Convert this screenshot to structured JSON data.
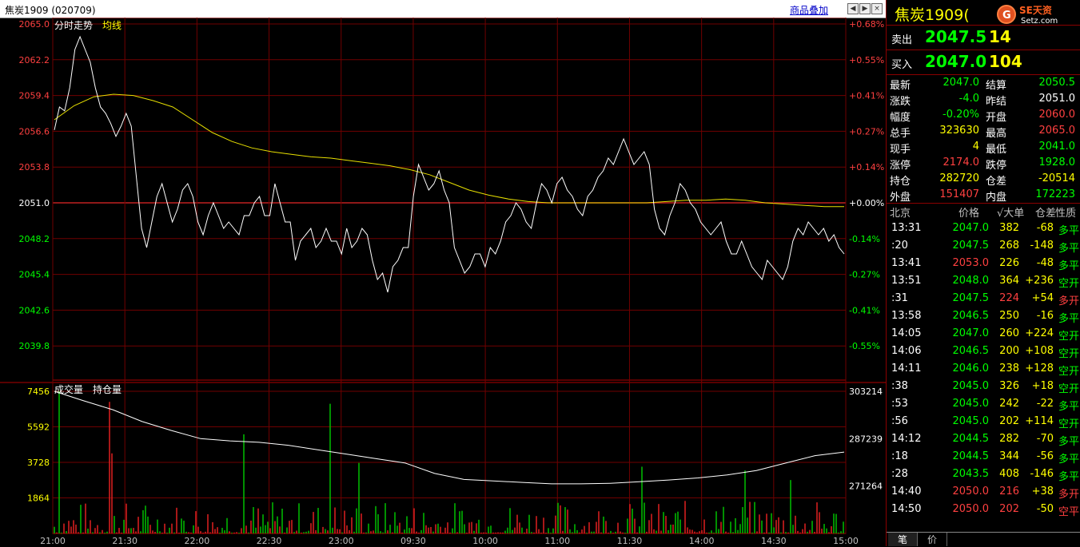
{
  "title_bar": {
    "title": "焦炭1909 (020709)",
    "overlay_label": "商品叠加"
  },
  "chart_data": [
    {
      "type": "line",
      "title": "分时走势",
      "legend": [
        "分时走势",
        "均线"
      ],
      "price_axis": [
        "2065.0",
        "2062.2",
        "2059.4",
        "2056.6",
        "2053.8",
        "2051.0",
        "2048.2",
        "2045.4",
        "2042.6",
        "2039.8"
      ],
      "pct_axis": [
        "+0.68%",
        "+0.55%",
        "+0.41%",
        "+0.27%",
        "+0.14%",
        "+0.00%",
        "-0.14%",
        "-0.27%",
        "-0.41%",
        "-0.55%"
      ],
      "ylim": [
        2037.0,
        2065.0
      ],
      "base_price": 2051.0,
      "x_ticks": [
        "21:00",
        "21:30",
        "22:00",
        "22:30",
        "23:00",
        "09:30",
        "10:00",
        "11:00",
        "11:30",
        "14:00",
        "14:30",
        "15:00"
      ],
      "series": [
        {
          "name": "分时走势",
          "values": [
            2056.7,
            2058.5,
            2058.2,
            2060.0,
            2063.0,
            2064.0,
            2063.0,
            2062.0,
            2060.0,
            2058.5,
            2058.0,
            2057.2,
            2056.2,
            2057.0,
            2058.0,
            2057.0,
            2053.0,
            2049.0,
            2047.5,
            2049.5,
            2051.5,
            2052.5,
            2051.0,
            2049.5,
            2050.5,
            2052.0,
            2052.5,
            2051.5,
            2049.5,
            2048.5,
            2050.0,
            2051.0,
            2050.0,
            2049.0,
            2049.5,
            2049.0,
            2048.5,
            2050.0,
            2050.0,
            2051.0,
            2051.5,
            2050.0,
            2050.0,
            2052.5,
            2051.0,
            2049.5,
            2049.5,
            2046.5,
            2048.0,
            2048.5,
            2049.0,
            2047.5,
            2048.0,
            2049.0,
            2048.0,
            2048.0,
            2047.0,
            2049.0,
            2047.5,
            2048.0,
            2049.0,
            2048.5,
            2046.5,
            2045.0,
            2045.5,
            2044.0,
            2046.0,
            2046.5,
            2047.5,
            2047.5,
            2051.5,
            2054.0,
            2053.0,
            2052.0,
            2052.5,
            2053.5,
            2052.0,
            2051.0,
            2047.5,
            2046.5,
            2045.5,
            2046.0,
            2047.0,
            2047.0,
            2046.0,
            2047.5,
            2047.0,
            2048.0,
            2049.5,
            2050.0,
            2051.0,
            2050.5,
            2049.5,
            2049.0,
            2051.0,
            2052.5,
            2052.0,
            2051.0,
            2052.5,
            2053.0,
            2052.0,
            2051.5,
            2050.5,
            2050.0,
            2051.5,
            2052.0,
            2053.0,
            2053.5,
            2054.5,
            2054.0,
            2055.0,
            2056.0,
            2055.0,
            2054.0,
            2054.5,
            2055.0,
            2054.0,
            2050.5,
            2049.0,
            2048.5,
            2050.0,
            2051.0,
            2052.5,
            2052.0,
            2051.0,
            2050.5,
            2049.5,
            2049.0,
            2048.5,
            2049.0,
            2049.5,
            2048.0,
            2047.0,
            2047.0,
            2048.0,
            2047.0,
            2046.0,
            2045.5,
            2045.0,
            2046.5,
            2046.0,
            2045.5,
            2045.0,
            2046.0,
            2048.0,
            2049.0,
            2048.5,
            2049.5,
            2049.0,
            2048.5,
            2049.0,
            2048.0,
            2048.5,
            2047.5,
            2047.0
          ]
        },
        {
          "name": "均线",
          "values": [
            2057.5,
            2058.6,
            2059.3,
            2059.5,
            2059.4,
            2059.0,
            2058.5,
            2057.5,
            2056.5,
            2055.8,
            2055.3,
            2055.0,
            2054.8,
            2054.6,
            2054.5,
            2054.3,
            2054.1,
            2053.9,
            2053.6,
            2053.2,
            2052.6,
            2052.0,
            2051.6,
            2051.3,
            2051.1,
            2051.0,
            2051.0,
            2051.0,
            2051.0,
            2051.0,
            2051.0,
            2051.1,
            2051.2,
            2051.2,
            2051.3,
            2051.2,
            2051.0,
            2050.9,
            2050.8,
            2050.7,
            2050.7
          ]
        }
      ]
    },
    {
      "type": "bar",
      "title": "成交量",
      "legend": [
        "成交量",
        "持仓量"
      ],
      "volume_axis": [
        "7456",
        "5592",
        "3728",
        "1864"
      ],
      "oi_axis": [
        "303214",
        "287239",
        "271264"
      ],
      "ylim": [
        0,
        7456
      ],
      "x_ticks": [
        "21:00",
        "21:30",
        "22:00",
        "22:30",
        "23:00",
        "09:30",
        "10:00",
        "11:00",
        "11:30",
        "14:00",
        "14:30",
        "15:00"
      ],
      "series": [
        {
          "name": "持仓量",
          "values": [
            303214,
            300000,
            297000,
            293000,
            290000,
            287239,
            286500,
            286000,
            285000,
            283500,
            282000,
            280500,
            279000,
            275500,
            273500,
            273000,
            272500,
            272000,
            272000,
            272200,
            272700,
            273300,
            274000,
            275000,
            276500,
            279000,
            281500,
            282720
          ]
        }
      ]
    }
  ],
  "side_panel": {
    "name": "焦炭1909(",
    "logo_text": "SE天资",
    "logo_sub": "Setz.com",
    "ask": {
      "label": "卖出",
      "price": "2047.5",
      "vol": "14"
    },
    "bid": {
      "label": "买入",
      "price": "2047.0",
      "vol": "104"
    },
    "quote": [
      {
        "l1": "最新",
        "v1": "2047.0",
        "c1": "#00ff00",
        "l2": "结算",
        "v2": "2050.5",
        "c2": "#00ff00"
      },
      {
        "l1": "涨跌",
        "v1": "-4.0",
        "c1": "#00ff00",
        "l2": "昨结",
        "v2": "2051.0",
        "c2": "#ffffff"
      },
      {
        "l1": "幅度",
        "v1": "-0.20%",
        "c1": "#00ff00",
        "l2": "开盘",
        "v2": "2060.0",
        "c2": "#ff4040"
      },
      {
        "l1": "总手",
        "v1": "323630",
        "c1": "#ffff00",
        "l2": "最高",
        "v2": "2065.0",
        "c2": "#ff4040"
      },
      {
        "l1": "现手",
        "v1": "4",
        "c1": "#ffff00",
        "l2": "最低",
        "v2": "2041.0",
        "c2": "#00ff00"
      },
      {
        "l1": "涨停",
        "v1": "2174.0",
        "c1": "#ff4040",
        "l2": "跌停",
        "v2": "1928.0",
        "c2": "#00ff00"
      },
      {
        "l1": "持仓",
        "v1": "282720",
        "c1": "#ffff00",
        "l2": "仓差",
        "v2": "-20514",
        "c2": "#ffff00"
      },
      {
        "l1": "外盘",
        "v1": "151407",
        "c1": "#ff4040",
        "l2": "内盘",
        "v2": "172223",
        "c2": "#00ff00"
      }
    ],
    "ticks_header": {
      "time": "北京",
      "price": "价格",
      "vol": "√大单",
      "oi": "仓差",
      "nature": "性质"
    },
    "ticks": [
      {
        "time": "13:31",
        "price": "2047.0",
        "pc": "#00ff00",
        "vol": "382",
        "vc": "#ffff00",
        "oi": "-68",
        "nature": "多平",
        "nc": "#00ff00"
      },
      {
        "time": ":20",
        "price": "2047.5",
        "pc": "#00ff00",
        "vol": "268",
        "vc": "#ffff00",
        "oi": "-148",
        "nature": "多平",
        "nc": "#00ff00"
      },
      {
        "time": "13:41",
        "price": "2053.0",
        "pc": "#ff4040",
        "vol": "226",
        "vc": "#ffff00",
        "oi": "-48",
        "nature": "多平",
        "nc": "#00ff00"
      },
      {
        "time": "13:51",
        "price": "2048.0",
        "pc": "#00ff00",
        "vol": "364",
        "vc": "#ffff00",
        "oi": "+236",
        "nature": "空开",
        "nc": "#00ff00"
      },
      {
        "time": ":31",
        "price": "2047.5",
        "pc": "#00ff00",
        "vol": "224",
        "vc": "#ff4040",
        "oi": "+54",
        "nature": "多开",
        "nc": "#ff4040"
      },
      {
        "time": "13:58",
        "price": "2046.5",
        "pc": "#00ff00",
        "vol": "250",
        "vc": "#ffff00",
        "oi": "-16",
        "nature": "多平",
        "nc": "#00ff00"
      },
      {
        "time": "14:05",
        "price": "2047.0",
        "pc": "#00ff00",
        "vol": "260",
        "vc": "#ffff00",
        "oi": "+224",
        "nature": "空开",
        "nc": "#00ff00"
      },
      {
        "time": "14:06",
        "price": "2046.5",
        "pc": "#00ff00",
        "vol": "200",
        "vc": "#ffff00",
        "oi": "+108",
        "nature": "空开",
        "nc": "#00ff00"
      },
      {
        "time": "14:11",
        "price": "2046.0",
        "pc": "#00ff00",
        "vol": "238",
        "vc": "#ffff00",
        "oi": "+128",
        "nature": "空开",
        "nc": "#00ff00"
      },
      {
        "time": ":38",
        "price": "2045.0",
        "pc": "#00ff00",
        "vol": "326",
        "vc": "#ffff00",
        "oi": "+18",
        "nature": "空开",
        "nc": "#00ff00"
      },
      {
        "time": ":53",
        "price": "2045.0",
        "pc": "#00ff00",
        "vol": "242",
        "vc": "#ffff00",
        "oi": "-22",
        "nature": "多平",
        "nc": "#00ff00"
      },
      {
        "time": ":56",
        "price": "2045.0",
        "pc": "#00ff00",
        "vol": "202",
        "vc": "#ffff00",
        "oi": "+114",
        "nature": "空开",
        "nc": "#00ff00"
      },
      {
        "time": "14:12",
        "price": "2044.5",
        "pc": "#00ff00",
        "vol": "282",
        "vc": "#ffff00",
        "oi": "-70",
        "nature": "多平",
        "nc": "#00ff00"
      },
      {
        "time": ":18",
        "price": "2044.5",
        "pc": "#00ff00",
        "vol": "344",
        "vc": "#ffff00",
        "oi": "-56",
        "nature": "多平",
        "nc": "#00ff00"
      },
      {
        "time": ":28",
        "price": "2043.5",
        "pc": "#00ff00",
        "vol": "408",
        "vc": "#ffff00",
        "oi": "-146",
        "nature": "多平",
        "nc": "#00ff00"
      },
      {
        "time": "14:40",
        "price": "2050.0",
        "pc": "#ff4040",
        "vol": "216",
        "vc": "#ff4040",
        "oi": "+38",
        "nature": "多开",
        "nc": "#ff4040"
      },
      {
        "time": "14:50",
        "price": "2050.0",
        "pc": "#ff4040",
        "vol": "202",
        "vc": "#ff4040",
        "oi": "-50",
        "nature": "空平",
        "nc": "#ff4040"
      }
    ],
    "tabs": [
      "笔",
      "价"
    ]
  }
}
